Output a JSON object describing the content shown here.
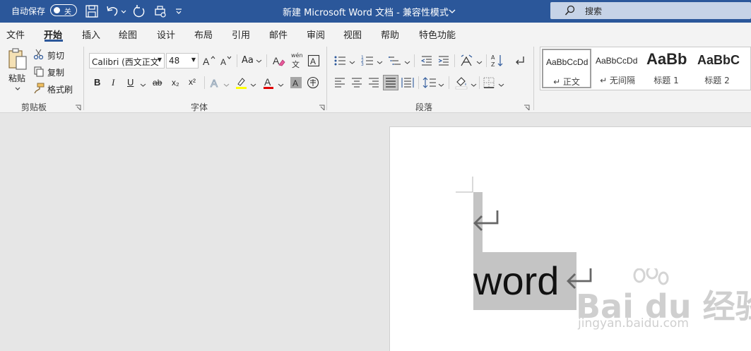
{
  "titlebar": {
    "autosave_label": "自动保存",
    "autosave_state": "关",
    "doc_title": "新建 Microsoft Word 文档  -  兼容性模式",
    "search_label": "搜索",
    "color": "#2b579a"
  },
  "menu": {
    "tabs": [
      "文件",
      "开始",
      "插入",
      "绘图",
      "设计",
      "布局",
      "引用",
      "邮件",
      "审阅",
      "视图",
      "帮助",
      "特色功能"
    ],
    "active": "开始"
  },
  "clipboard": {
    "paste": "粘贴",
    "cut": "剪切",
    "copy": "复制",
    "format_painter": "格式刷",
    "group": "剪贴板"
  },
  "font": {
    "font_name": "Calibri (西文正文",
    "font_size": "48",
    "change_case": "Aa",
    "phonetic_top": "wén",
    "phonetic_bottom": "文",
    "bold": "B",
    "italic": "I",
    "underline": "U",
    "strike": "ab",
    "subscript": "x₂",
    "superscript": "x²",
    "group": "字体"
  },
  "paragraph": {
    "group": "段落"
  },
  "styles": {
    "items": [
      {
        "preview": "AaBbCcDd",
        "name": "↵ 正文"
      },
      {
        "preview": "AaBbCcDd",
        "name": "↵ 无间隔"
      },
      {
        "preview": "AaBb",
        "name": "标题 1"
      },
      {
        "preview": "AaBbC",
        "name": "标题 2"
      }
    ]
  },
  "document": {
    "text": "word",
    "selection_color": "#c4c4c4"
  },
  "watermark": {
    "brand": "Bai du 经验",
    "url": "jingyan.baidu.com"
  }
}
